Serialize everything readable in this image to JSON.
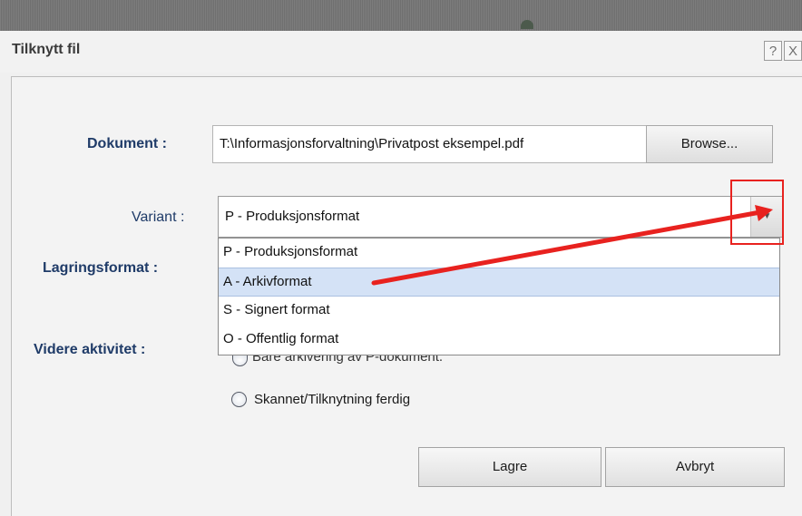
{
  "dialog": {
    "title": "Tilknytt fil",
    "help_label": "?",
    "close_label": "X"
  },
  "document": {
    "label": "Dokument :",
    "value": "T:\\Informasjonsforvaltning\\Privatpost eksempel.pdf",
    "browse_label": "Browse..."
  },
  "variant": {
    "label": "Variant :",
    "selected": "P - Produksjonsformat",
    "options": [
      "P - Produksjonsformat",
      "A - Arkivformat",
      "S - Signert format",
      "O - Offentlig format"
    ],
    "highlighted_index": 1
  },
  "storage": {
    "label": "Lagringsformat :"
  },
  "activity": {
    "label": "Videre aktivitet :",
    "options": [
      "Bare arkivering av P-dokument.",
      "Skannet/Tilknytning ferdig"
    ]
  },
  "buttons": {
    "save": "Lagre",
    "cancel": "Avbryt"
  },
  "colors": {
    "label_blue": "#1f3b68",
    "annotation_red": "#e8221f",
    "highlight": "#d4e2f6"
  }
}
